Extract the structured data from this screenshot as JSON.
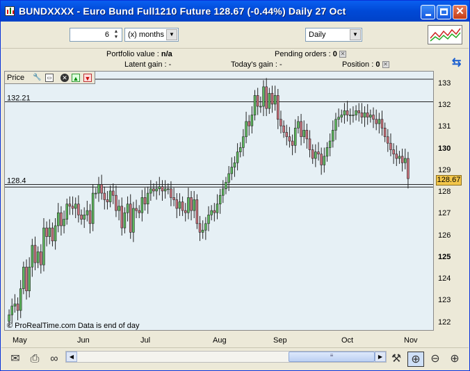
{
  "window": {
    "title": "BUNDXXXX - Euro Bund Full1210 Future     128.67 (-0.44%)     Daily  27 Oct",
    "minimize_icon": "minimize-icon",
    "maximize_icon": "maximize-icon",
    "close_icon": "close-icon"
  },
  "toolbar": {
    "period_value": "6",
    "period_unit": "(x) months",
    "timeframe": "Daily"
  },
  "info": {
    "portfolio_label": "Portfolio value :",
    "portfolio_value": "n/a",
    "pending_label": "Pending orders :",
    "pending_value": "0",
    "latent_label": "Latent gain :",
    "latent_value": "-",
    "today_label": "Today's gain :",
    "today_value": "-",
    "position_label": "Position :",
    "position_value": "0"
  },
  "chart_toolbar": {
    "label": "Price"
  },
  "chart_data": {
    "type": "candlestick",
    "instrument": "Euro Bund Full1210 Future",
    "last_price": "128.67",
    "ylim": [
      121.7,
      133.6
    ],
    "price_ticks": [
      "133",
      "132",
      "131",
      "130",
      "129",
      "128",
      "127",
      "126",
      "125",
      "124",
      "123",
      "122"
    ],
    "bold_ticks": [
      "130",
      "125"
    ],
    "month_labels": [
      "May",
      "Jun",
      "Jul",
      "Aug",
      "Sep",
      "Oct",
      "Nov"
    ],
    "horizontal_lines": [
      {
        "label": "132.21",
        "value": 132.21
      },
      {
        "label": "128.4",
        "value": 128.4
      },
      {
        "label": "",
        "value": 128.28
      },
      {
        "label": "",
        "value": 133.25
      }
    ],
    "candles_close": [
      122.4,
      122.8,
      122.9,
      122.6,
      123.6,
      124.6,
      123.5,
      124.6,
      125.6,
      124.8,
      125.3,
      124.7,
      126.4,
      126.0,
      126.4,
      125.8,
      126.5,
      127.1,
      126.5,
      126.8,
      127.5,
      127.4,
      127.3,
      127.5,
      127.0,
      126.8,
      127.0,
      127.2,
      126.6,
      128.0,
      128.0,
      128.4,
      128.0,
      127.7,
      127.6,
      128.1,
      127.9,
      127.2,
      127.4,
      126.4,
      127.1,
      127.5,
      126.2,
      127.3,
      127.2,
      127.1,
      127.8,
      127.5,
      128.0,
      128.2,
      128.1,
      128.2,
      128.3,
      128.1,
      128.2,
      128.2,
      127.8,
      127.7,
      127.3,
      127.6,
      127.2,
      127.1,
      127.8,
      127.2,
      127.7,
      126.6,
      126.2,
      126.3,
      126.6,
      127.0,
      127.2,
      127.1,
      127.5,
      127.9,
      128.2,
      128.5,
      128.9,
      129.2,
      129.4,
      129.9,
      130.1,
      130.6,
      131.3,
      131.1,
      131.6,
      132.5,
      132.0,
      132.0,
      132.9,
      131.9,
      132.6,
      132.1,
      132.5,
      131.4,
      131.1,
      130.8,
      130.6,
      130.4,
      130.2,
      131.0,
      131.3,
      130.6,
      130.9,
      130.5,
      130.0,
      129.6,
      129.9,
      129.8,
      129.3,
      129.7,
      130.1,
      130.4,
      130.9,
      131.4,
      131.5,
      131.6,
      131.8,
      131.6,
      131.6,
      131.6,
      131.8,
      131.7,
      131.5,
      131.7,
      131.5,
      131.6,
      131.4,
      131.2,
      131.4,
      131.0,
      130.6,
      130.3,
      130.0,
      129.8,
      129.6,
      129.7,
      129.4,
      129.6,
      128.67
    ],
    "source_note": "© ProRealTime.com  Data is end of day"
  },
  "bottom_bar": {
    "mail_icon": "mail-icon",
    "print_icon": "print-icon",
    "link_icon": "link-icon",
    "tools_icon": "tools-icon",
    "zoom_fit_icon": "zoom-fit-icon",
    "zoom_out_icon": "zoom-out-icon",
    "zoom_in_icon": "zoom-in-icon"
  },
  "colors": {
    "up": "#5cb85c",
    "down": "#c9707a",
    "chart_bg": "#e6f0f5",
    "last_price_bg": "#f3c64a"
  }
}
